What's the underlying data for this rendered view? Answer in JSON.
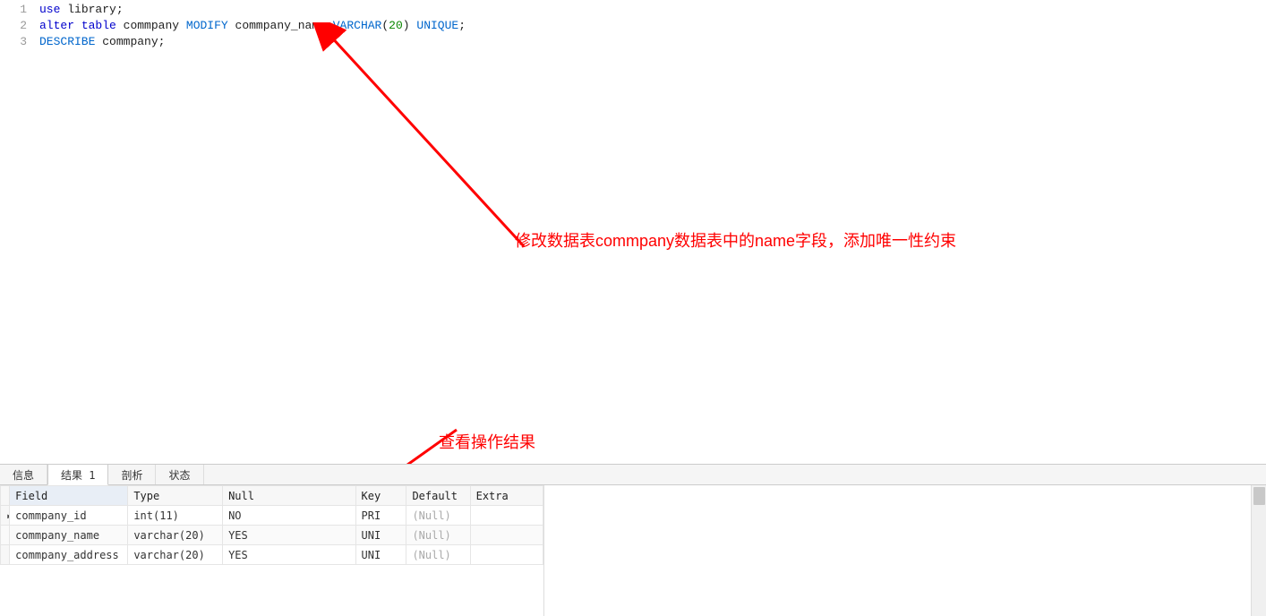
{
  "editor": {
    "lines": [
      {
        "num": "1",
        "tokens": [
          {
            "cls": "tok-kw",
            "t": "use"
          },
          {
            "cls": "",
            "t": " "
          },
          {
            "cls": "tok-id",
            "t": "library"
          },
          {
            "cls": "tok-punc",
            "t": ";"
          }
        ]
      },
      {
        "num": "2",
        "tokens": [
          {
            "cls": "tok-kw",
            "t": "alter"
          },
          {
            "cls": "",
            "t": " "
          },
          {
            "cls": "tok-kw",
            "t": "table"
          },
          {
            "cls": "",
            "t": " "
          },
          {
            "cls": "tok-id",
            "t": "commpany"
          },
          {
            "cls": "",
            "t": " "
          },
          {
            "cls": "tok-mod",
            "t": "MODIFY"
          },
          {
            "cls": "",
            "t": " "
          },
          {
            "cls": "tok-id",
            "t": "commpany_name"
          },
          {
            "cls": "",
            "t": " "
          },
          {
            "cls": "tok-type",
            "t": "VARCHAR"
          },
          {
            "cls": "tok-punc",
            "t": "("
          },
          {
            "cls": "tok-num",
            "t": "20"
          },
          {
            "cls": "tok-punc",
            "t": ")"
          },
          {
            "cls": "",
            "t": " "
          },
          {
            "cls": "tok-mod",
            "t": "UNIQUE"
          },
          {
            "cls": "tok-punc",
            "t": ";"
          }
        ]
      },
      {
        "num": "3",
        "tokens": [
          {
            "cls": "tok-mod",
            "t": "DESCRIBE"
          },
          {
            "cls": "",
            "t": " "
          },
          {
            "cls": "tok-id",
            "t": "commpany"
          },
          {
            "cls": "tok-punc",
            "t": ";"
          }
        ]
      }
    ]
  },
  "annotations": {
    "note1": "修改数据表commpany数据表中的name字段，添加唯一性约束",
    "note2": "查看操作结果"
  },
  "tabs": {
    "info": "信息",
    "result": "结果 1",
    "profile": "剖析",
    "status": "状态"
  },
  "grid": {
    "headers": {
      "field": "Field",
      "type": "Type",
      "null": "Null",
      "key": "Key",
      "default": "Default",
      "extra": "Extra"
    },
    "rows": [
      {
        "field": "commpany_id",
        "type": "int(11)",
        "null": "NO",
        "key": "PRI",
        "default": "(Null)",
        "extra": "",
        "indicator": "▸"
      },
      {
        "field": "commpany_name",
        "type": "varchar(20)",
        "null": "YES",
        "key": "UNI",
        "default": "(Null)",
        "extra": "",
        "indicator": ""
      },
      {
        "field": "commpany_address",
        "type": "varchar(20)",
        "null": "YES",
        "key": "UNI",
        "default": "(Null)",
        "extra": "",
        "indicator": ""
      }
    ]
  }
}
